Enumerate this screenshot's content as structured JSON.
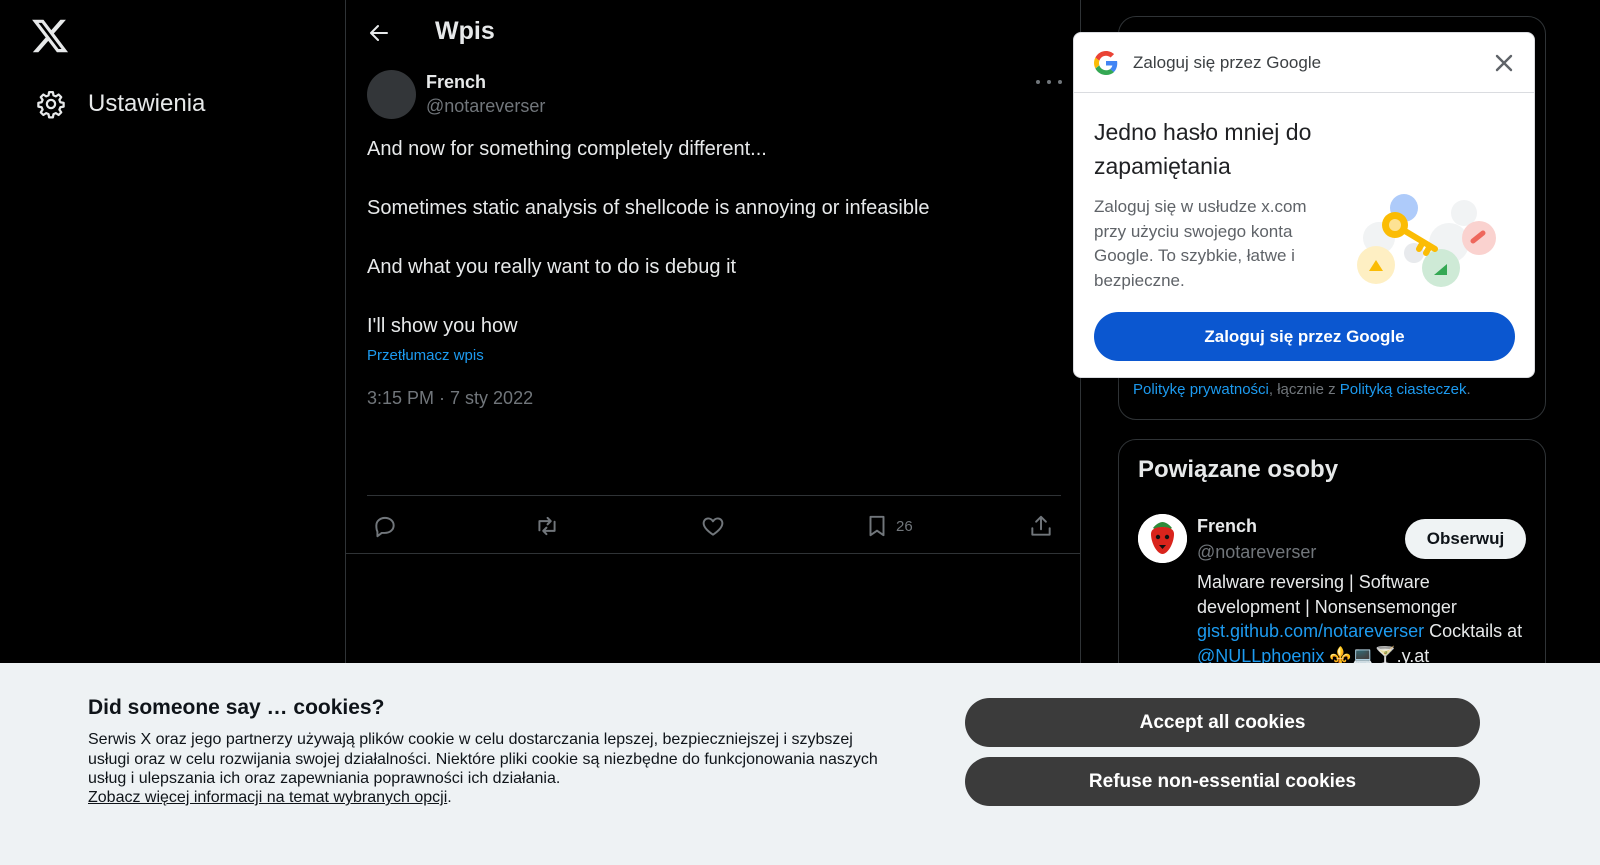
{
  "nav": {
    "logo_icon": "x-logo-icon",
    "settings_label": "Ustawienia",
    "settings_icon": "gear-icon"
  },
  "header": {
    "title": "Wpis",
    "back_icon": "arrow-left-icon"
  },
  "tweet": {
    "author_name": "French",
    "author_handle": "@notareverser",
    "lines": [
      "And now for something completely different...",
      "Sometimes static analysis of shellcode is annoying or infeasible",
      "And what you really want to do is debug it",
      "I'll show you how"
    ],
    "translate_label": "Przetłumacz wpis",
    "timestamp": "3:15 PM · 7 sty 2022",
    "bookmark_count": "26"
  },
  "sidebar": {
    "privacy_prefix": "",
    "privacy_link": "Politykę prywatności",
    "privacy_mid": ", łącznie z ",
    "cookie_policy_link": "Polityką ciasteczek",
    "privacy_suffix": ".",
    "related_title": "Powiązane osoby",
    "related_user": {
      "name": "French",
      "handle": "@notareverser",
      "follow_label": "Obserwuj",
      "bio_line1": "Malware reversing | Software development | Nonsensemonger",
      "bio_link": "gist.github.com/notareverser",
      "bio_mid": " Cocktails at ",
      "bio_mention": "@NULLphoenix",
      "bio_emoji": " ⚜️💻🍸",
      "bio_end": ".y.at"
    }
  },
  "google_popup": {
    "header": "Zaloguj się przez Google",
    "title": "Jedno hasło mniej do zapamiętania",
    "description": "Zaloguj się w usłudze x.com przy użyciu swojego konta Google. To szybkie, łatwe i bezpieczne.",
    "button": "Zaloguj się przez Google",
    "brand_colors": [
      "#4285F4",
      "#EA4335",
      "#FBBC05",
      "#34A853"
    ],
    "button_color": "#0b57d0"
  },
  "cookies": {
    "title": "Did someone say … cookies?",
    "body": "Serwis X oraz jego partnerzy używają plików cookie w celu dostarczania lepszej, bezpieczniejszej i szybszej usługi oraz w celu rozwijania swojej działalności. Niektóre pliki cookie są niezbędne do funkcjonowania naszych usług i ulepszania ich oraz zapewniania poprawności ich działania.",
    "link": "Zobacz więcej informacji na temat wybranych opcji",
    "link_suffix": ".",
    "accept": "Accept all cookies",
    "refuse": "Refuse non-essential cookies"
  },
  "colors": {
    "background": "#000000",
    "accent": "#1d9bf0",
    "muted": "#71767b",
    "border": "#2f3336"
  }
}
